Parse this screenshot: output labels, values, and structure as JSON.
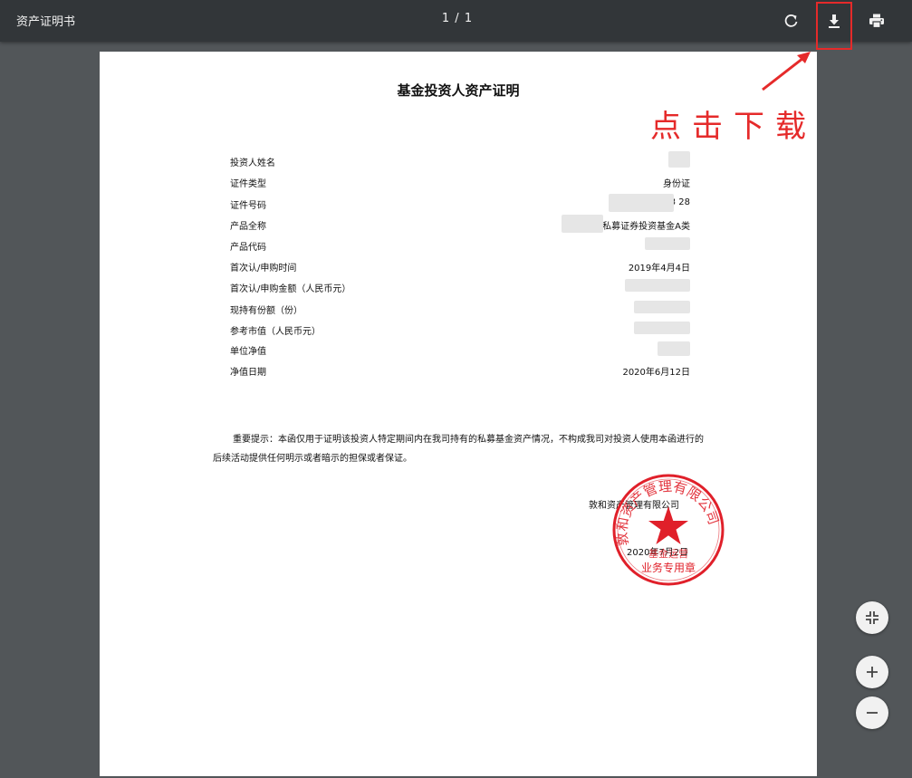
{
  "toolbar": {
    "title": "资产证明书",
    "page_counter": "1 / 1",
    "icons": {
      "rotate": "rotate-icon",
      "download": "download-icon",
      "print": "print-icon"
    }
  },
  "annotation": {
    "text": "点击下载",
    "color": "#e52a2a"
  },
  "document": {
    "heading": "基金投资人资产证明",
    "rows": [
      {
        "label": "投资人姓名",
        "value": ""
      },
      {
        "label": "证件类型",
        "value": "身份证"
      },
      {
        "label": "证件号码",
        "value": "4403                    28"
      },
      {
        "label": "产品全称",
        "value": "敦和              私募证券投资基金A类"
      },
      {
        "label": "产品代码",
        "value": ""
      },
      {
        "label": "首次认/申购时间",
        "value": "2019年4月4日"
      },
      {
        "label": "首次认/申购金额（人民币元）",
        "value": ""
      },
      {
        "label": "现持有份额（份）",
        "value": ""
      },
      {
        "label": "参考市值（人民币元）",
        "value": ""
      },
      {
        "label": "单位净值",
        "value": ""
      },
      {
        "label": "净值日期",
        "value": "2020年6月12日"
      }
    ],
    "notice": "重要提示：本函仅用于证明该投资人特定期间内在我司持有的私募基金资产情况，不构成我司对投资人使用本函进行的后续活动提供任何明示或者暗示的担保或者保证。",
    "company": "敦和资产管理有限公司",
    "issue_date": "2020年7月2日",
    "seal": {
      "ring_text": "敦和资产管理有限公司",
      "center_line1": "基金运营",
      "center_line2": "业务专用章",
      "color": "#e0202a"
    }
  },
  "controls": {
    "fit_icon": "fit-to-page-icon",
    "zoom_in_icon": "plus-icon",
    "zoom_out_icon": "minus-icon"
  }
}
